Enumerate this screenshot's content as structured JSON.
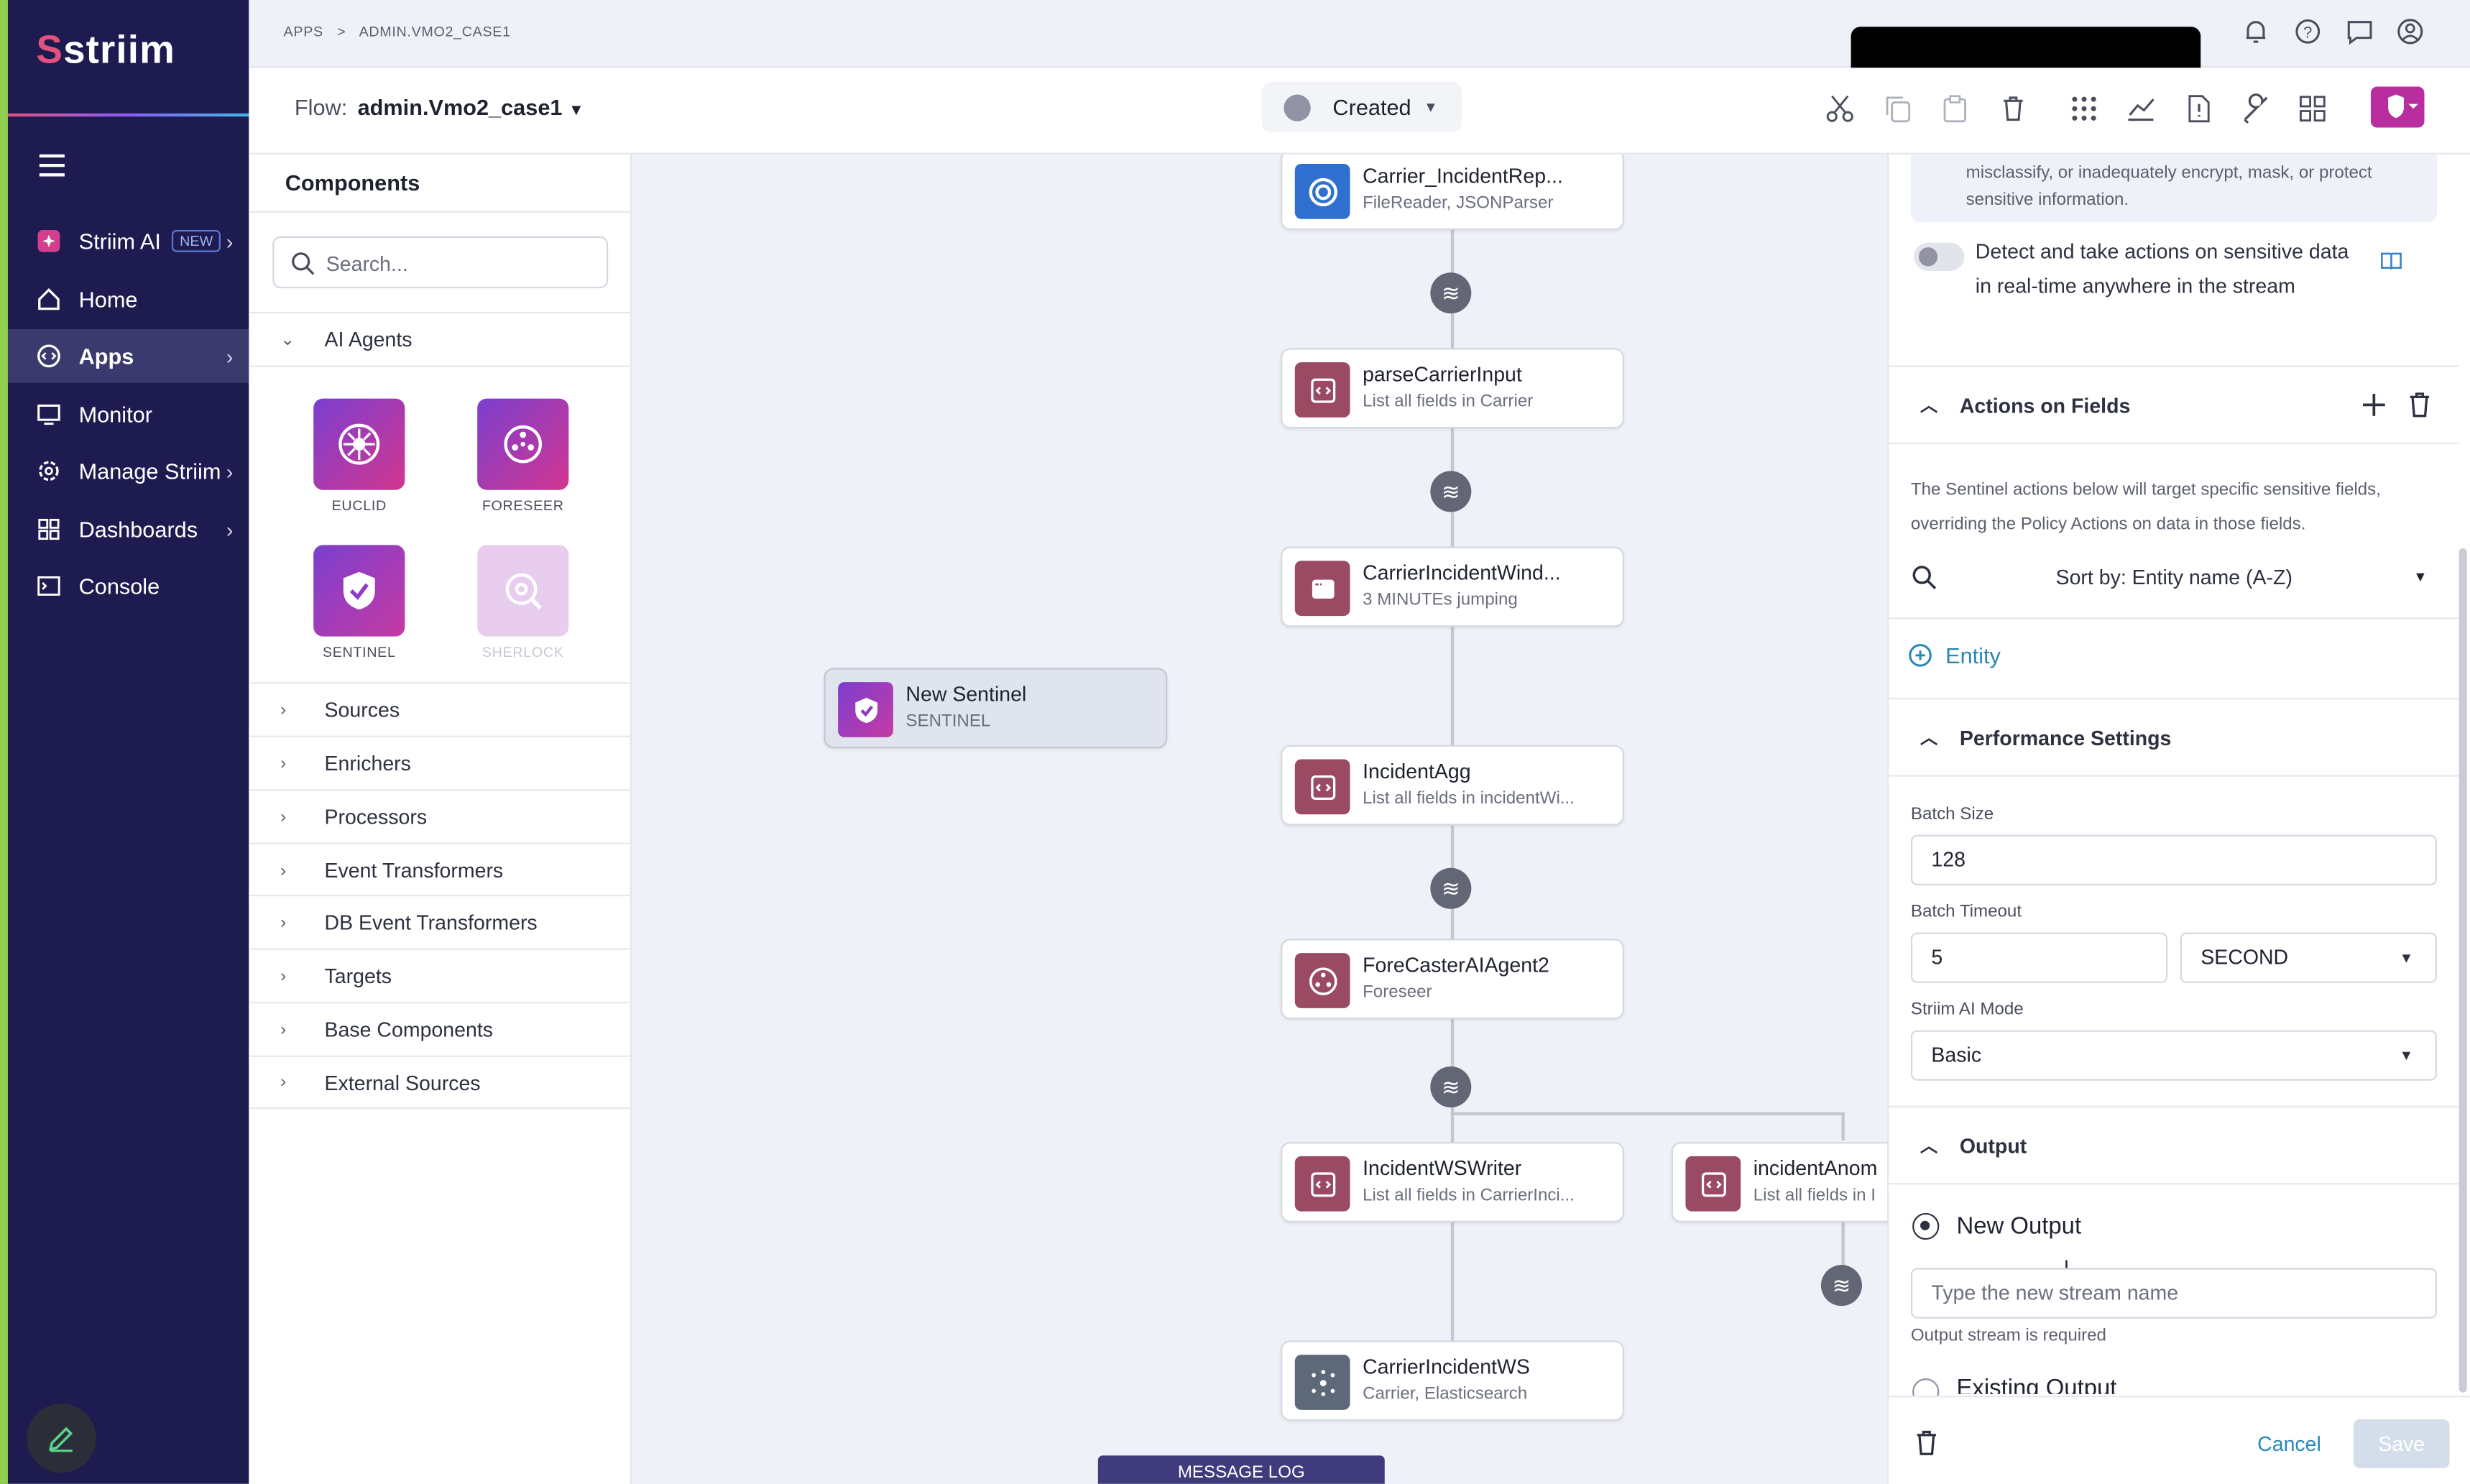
{
  "app": {
    "brand": "striim",
    "accent": "#1d1b4f",
    "brand_pink": "#e3527f"
  },
  "nav": {
    "items": [
      {
        "label": "Striim AI",
        "badge": "NEW",
        "icon": "sparkle-icon",
        "chevron": true
      },
      {
        "label": "Home",
        "icon": "home-icon"
      },
      {
        "label": "Apps",
        "icon": "apps-icon",
        "chevron": true,
        "active": true
      },
      {
        "label": "Monitor",
        "icon": "monitor-icon"
      },
      {
        "label": "Manage Striim",
        "icon": "gear-icon",
        "chevron": true
      },
      {
        "label": "Dashboards",
        "icon": "dashboard-icon",
        "chevron": true
      },
      {
        "label": "Console",
        "icon": "console-icon"
      }
    ]
  },
  "breadcrumb": {
    "root": "APPS",
    "separator": ">",
    "current": "ADMIN.VMO2_CASE1"
  },
  "flow": {
    "label": "Flow:",
    "name": "admin.Vmo2_case1",
    "status": "Created"
  },
  "components": {
    "title": "Components",
    "search_placeholder": "Search...",
    "ai_agents_label": "AI Agents",
    "agents": [
      {
        "name": "EUCLID",
        "color": "#b5319e"
      },
      {
        "name": "FORESEER",
        "color": "#b5319e"
      },
      {
        "name": "SENTINEL",
        "color": "#7b3fcf"
      },
      {
        "name": "SHERLOCK",
        "color": "#e6c6ec"
      }
    ],
    "categories": [
      "Sources",
      "Enrichers",
      "Processors",
      "Event Transformers",
      "DB Event Transformers",
      "Targets",
      "Base Components",
      "External Sources"
    ]
  },
  "canvas": {
    "nodes": [
      {
        "title": "Carrier_IncidentRep...",
        "subtitle": "FileReader, JSONParser"
      },
      {
        "title": "parseCarrierInput",
        "subtitle": "List all fields in Carrier"
      },
      {
        "title": "CarrierIncidentWind...",
        "subtitle": "3 MINUTEs jumping"
      },
      {
        "title": "IncidentAgg",
        "subtitle": "List all fields in incidentWi..."
      },
      {
        "title": "ForeCasterAIAgent2",
        "subtitle": "Foreseer"
      },
      {
        "title": "IncidentWSWriter",
        "subtitle": "List all fields in CarrierInci..."
      },
      {
        "title": "incidentAnom",
        "subtitle": "List all fields in I"
      },
      {
        "title": "CarrierIncidentWS",
        "subtitle": "Carrier, Elasticsearch"
      }
    ],
    "new_sentinel": {
      "title": "New Sentinel",
      "subtitle": "SENTINEL"
    },
    "message_log": "MESSAGE LOG"
  },
  "panel": {
    "warning_text": "misclassify, or inadequately encrypt, mask, or protect sensitive information.",
    "detect_toggle": {
      "label": "Detect and take actions on sensitive data in real-time anywhere in the stream",
      "on": false
    },
    "actions_on_fields": {
      "title": "Actions on Fields",
      "description": "The Sentinel actions below will target specific sensitive fields, overriding the Policy Actions on data in those fields.",
      "sort_label": "Sort by: Entity name (A-Z)",
      "add_entity_label": "Entity"
    },
    "performance": {
      "title": "Performance Settings",
      "batch_size_label": "Batch Size",
      "batch_size": "128",
      "batch_timeout_label": "Batch Timeout",
      "batch_timeout": "5",
      "batch_timeout_unit": "SECOND",
      "ai_mode_label": "Striim AI Mode",
      "ai_mode": "Basic"
    },
    "output": {
      "title": "Output",
      "new_output_label": "New Output",
      "new_output_selected": true,
      "stream_placeholder": "Type the new stream name",
      "error": "Output stream is required",
      "existing_output_label": "Existing Output"
    },
    "footer": {
      "cancel": "Cancel",
      "save": "Save"
    }
  }
}
